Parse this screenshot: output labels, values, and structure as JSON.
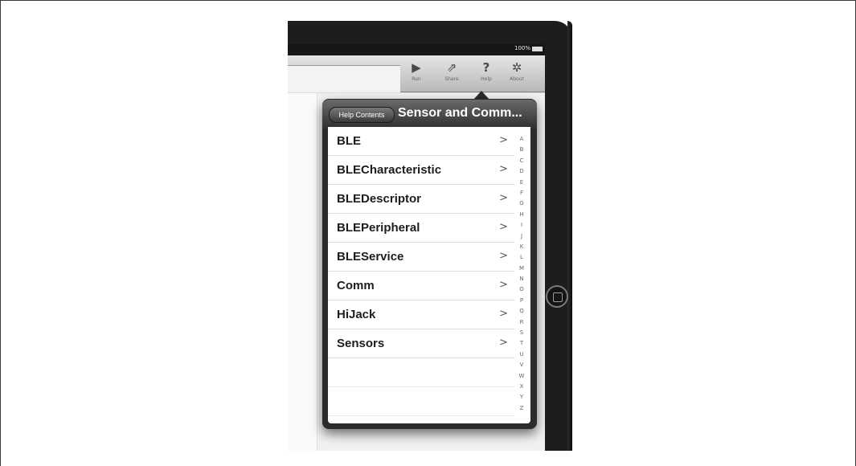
{
  "status": {
    "battery": "100%"
  },
  "toolbar": {
    "items": [
      {
        "label": "Run",
        "icon": "play-icon",
        "glyph": "▶"
      },
      {
        "label": "Share",
        "icon": "share-icon",
        "glyph": "⇗"
      },
      {
        "label": "Help",
        "icon": "help-icon",
        "glyph": "?"
      },
      {
        "label": "About",
        "icon": "gear-icon",
        "glyph": "✲"
      }
    ]
  },
  "popover": {
    "back_label": "Help Contents",
    "title": "Sensor and Comm...",
    "rows": [
      {
        "label": "BLE",
        "chevron": ">"
      },
      {
        "label": "BLECharacteristic",
        "chevron": ">"
      },
      {
        "label": "BLEDescriptor",
        "chevron": ">"
      },
      {
        "label": "BLEPeripheral",
        "chevron": ">"
      },
      {
        "label": "BLEService",
        "chevron": ">"
      },
      {
        "label": "Comm",
        "chevron": ">"
      },
      {
        "label": "HiJack",
        "chevron": ">"
      },
      {
        "label": "Sensors",
        "chevron": ">"
      }
    ],
    "index_letters": [
      "A",
      "B",
      "C",
      "D",
      "E",
      "F",
      "G",
      "H",
      "I",
      "J",
      "K",
      "L",
      "M",
      "N",
      "O",
      "P",
      "Q",
      "R",
      "S",
      "T",
      "U",
      "V",
      "W",
      "X",
      "Y",
      "Z"
    ]
  }
}
